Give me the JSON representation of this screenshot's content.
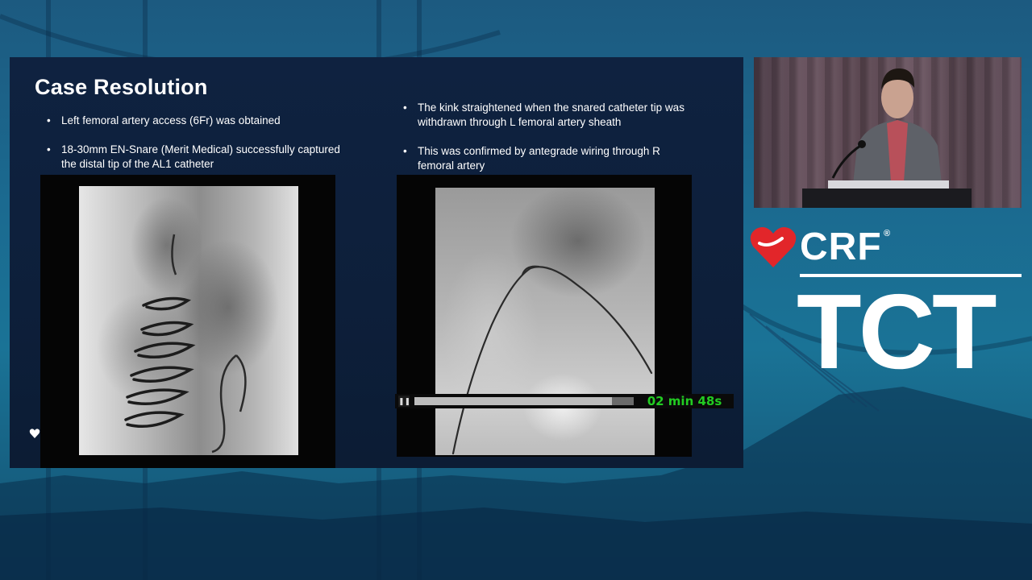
{
  "slide": {
    "title": "Case Resolution",
    "left_bullets": [
      "Left femoral artery access (6Fr) was obtained",
      "18-30mm EN-Snare (Merit Medical) successfully captured the distal tip of the AL1 catheter"
    ],
    "right_bullets": [
      "The kink straightened when the snared catheter tip was withdrawn through L femoral artery sheath",
      "This was confirmed by antegrade wiring through R femoral artery"
    ]
  },
  "video_player": {
    "pause_label": "❚❚",
    "time_readout": "02 min 48s",
    "progress_fraction": 0.9
  },
  "branding": {
    "crf_label": "CRF",
    "registered_mark": "®",
    "tct_label": "TCT",
    "heart_color": "#e2262a"
  },
  "colors": {
    "slide_bg": "#0f2240",
    "timer_text": "#22cc22"
  }
}
